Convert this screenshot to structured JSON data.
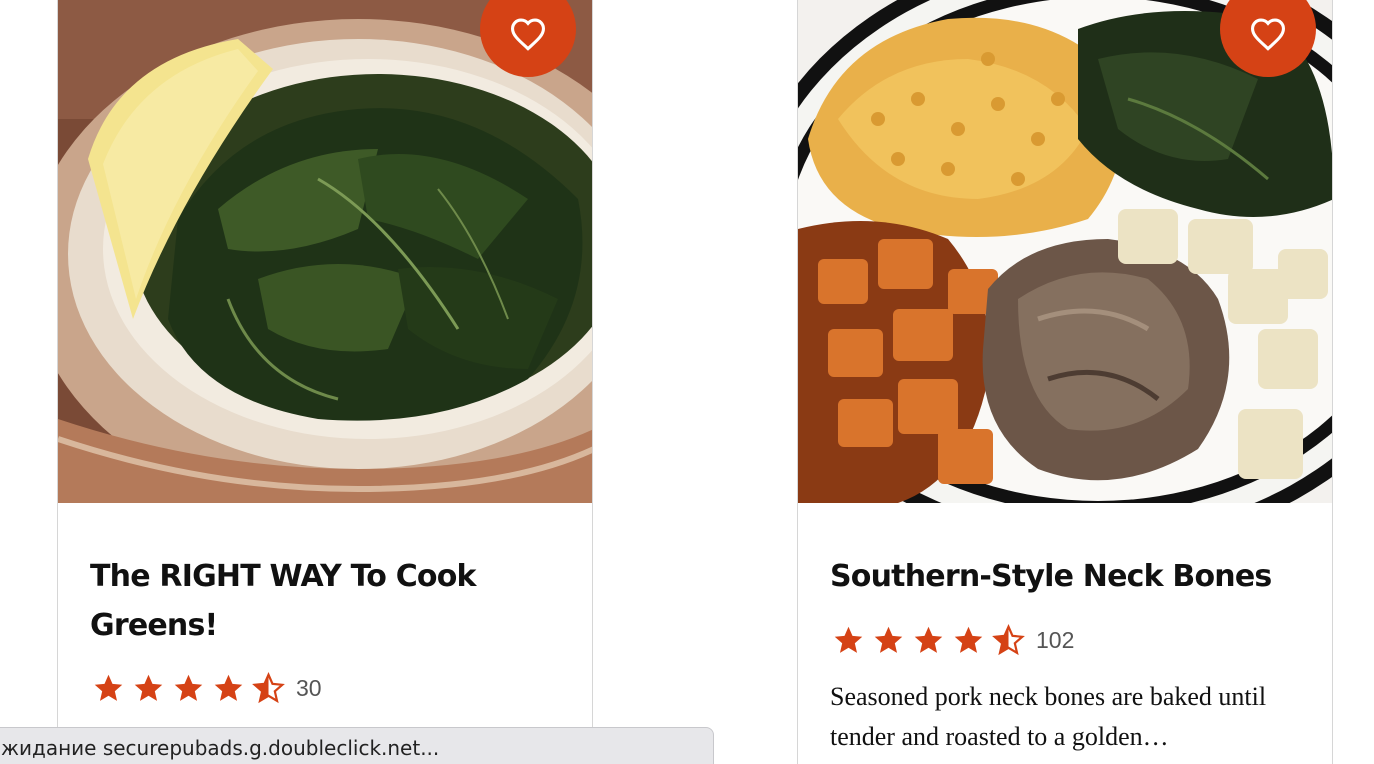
{
  "cards": [
    {
      "title": "The RIGHT WAY To Cook Greens!",
      "rating_value": 4.5,
      "rating_count": "30",
      "description": "",
      "image": "bowl of cooked collard greens with a lemon wedge",
      "favorite_icon": "heart-outline-icon"
    },
    {
      "title": "Southern-Style Neck Bones",
      "rating_value": 4.5,
      "rating_count": "102",
      "description": "Seasoned pork neck bones are baked until tender and roasted to a golden…",
      "image": "plate of mac and cheese, collard greens, sweet potatoes, potatoes and neck bones",
      "favorite_icon": "heart-outline-icon"
    }
  ],
  "status_bar": {
    "text": "жидание securepubads.g.doubleclick.net..."
  },
  "colors": {
    "accent": "#d54215",
    "title_text": "#111111",
    "card_border": "#d6d6d6",
    "status_bg": "#e7e7ea"
  }
}
